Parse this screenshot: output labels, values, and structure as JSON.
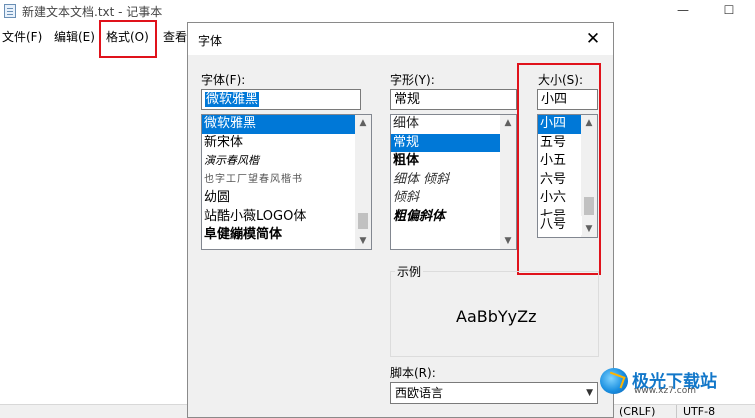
{
  "notepad": {
    "title": "新建文本文档.txt - 记事本",
    "controls": {
      "minimize": "—",
      "maximize": "☐"
    },
    "menus": [
      "文件(F)",
      "编辑(E)",
      "格式(O)",
      "查看"
    ],
    "status": [
      "(CRLF)",
      "UTF-8"
    ]
  },
  "dialog": {
    "title": "字体",
    "close_glyph": "✕",
    "font": {
      "label": "字体(F):",
      "value": "微软雅黑",
      "items": [
        "微软雅黑",
        "新宋体",
        "演示春风楷",
        "也字工厂望春风楷书",
        "幼圆",
        "站酷小薇LOGO体",
        "阜健繃模简体"
      ],
      "selected_index": 0
    },
    "style": {
      "label": "字形(Y):",
      "value": "常规",
      "items": [
        "细体",
        "常规",
        "粗体",
        "细体 倾斜",
        "倾斜",
        "粗偏斜体"
      ],
      "selected_index": 1
    },
    "size": {
      "label": "大小(S):",
      "value": "小四",
      "items": [
        "小四",
        "五号",
        "小五",
        "六号",
        "小六",
        "七号",
        "八号"
      ],
      "selected_index": 0
    },
    "sample": {
      "label": "示例",
      "text": "AaBbYyZz"
    },
    "script": {
      "label": "脚本(R):",
      "value": "西欧语言"
    }
  },
  "watermark": {
    "name": "极光下载站",
    "url": "www.xz7.com"
  }
}
